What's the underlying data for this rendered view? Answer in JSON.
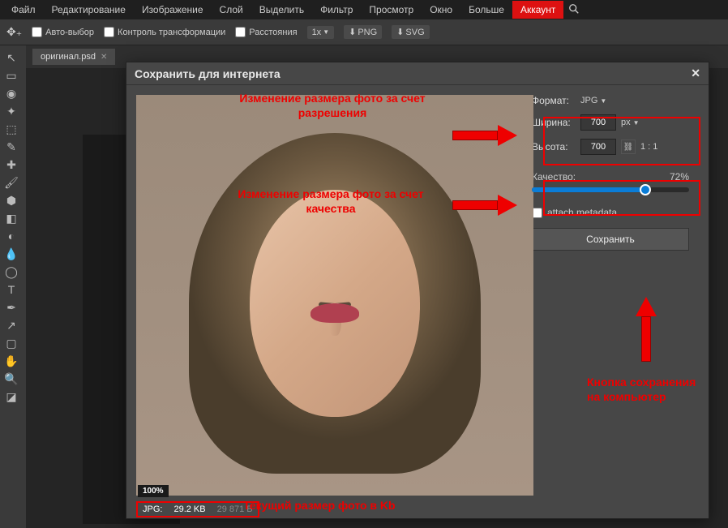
{
  "menu": {
    "items": [
      "Файл",
      "Редактирование",
      "Изображение",
      "Слой",
      "Выделить",
      "Фильтр",
      "Просмотр",
      "Окно",
      "Больше",
      "Аккаунт"
    ]
  },
  "options": {
    "auto_select": "Авто-выбор",
    "transform_controls": "Контроль трансформации",
    "distances": "Расстояния",
    "zoom": "1x",
    "png": "PNG",
    "svg": "SVG"
  },
  "tab": {
    "filename": "оригинал.psd"
  },
  "dialog": {
    "title": "Сохранить для интернета",
    "format_label": "Формат:",
    "format_value": "JPG",
    "width_label": "Ширина:",
    "width_value": "700",
    "height_label": "Высота:",
    "height_value": "700",
    "unit": "px",
    "ratio": "1 : 1",
    "quality_label": "Качество:",
    "quality_value": "72%",
    "quality_pct": 72,
    "metadata_label": "attach metadata",
    "save_label": "Сохранить",
    "zoom_label": "100%",
    "status_format": "JPG:",
    "status_size": "29.2 KB",
    "status_bytes": "29 871 B"
  },
  "annotations": {
    "resize_resolution": "Изменение размера фото за счет разрешения",
    "resize_quality": "Изменение размера фото за счет качества",
    "save_button_note": "Кнопка сохранения на компьютер",
    "current_size_note": "Текущий размер фото в Kb"
  }
}
